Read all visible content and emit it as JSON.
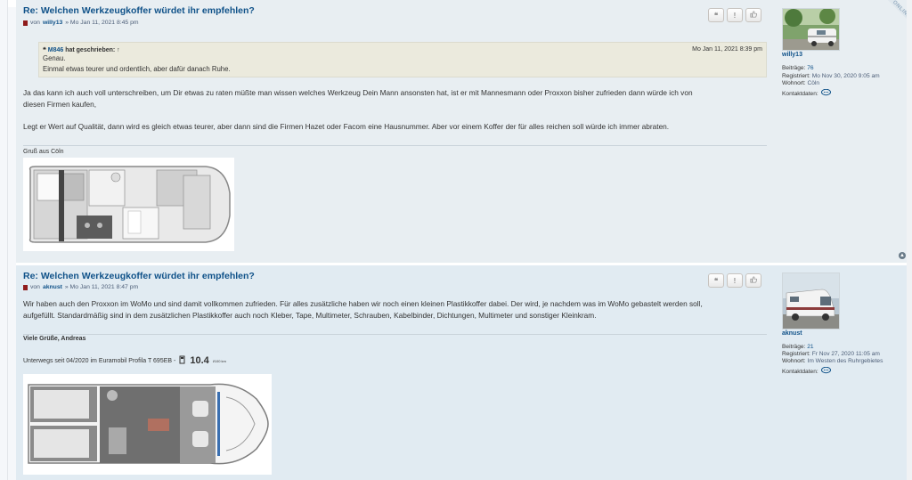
{
  "post1": {
    "title": "Re: Welchen Werkzeugkoffer würdet ihr empfehlen?",
    "by_prefix": "von",
    "author": "willy13",
    "date": "» Mo Jan 11, 2021 8:45 pm",
    "quote": {
      "name": "M846",
      "wrote": "hat geschrieben: ↑",
      "date": "Mo Jan 11, 2021 8:39 pm",
      "lines": [
        "Genau.",
        "Einmal etwas teurer und ordentlich, aber dafür danach Ruhe."
      ]
    },
    "body": [
      "Ja das kann ich auch voll unterschreiben, um Dir etwas zu raten müßte man wissen welches Werkzeug Dein Mann ansonsten hat, ist er mit Mannesmann oder Proxxon bisher zufrieden dann würde ich von",
      "diesen Firmen kaufen,",
      "Legt er Wert auf Qualität, dann wird es gleich etwas teurer, aber dann sind die Firmen Hazet oder Facom eine Hausnummer. Aber vor einem Koffer der für alles reichen soll würde ich immer abraten."
    ],
    "signature": "Gruß aus Cöln",
    "profile": {
      "username": "willy13",
      "online_badge": "ONLINE",
      "posts_label": "Beiträge:",
      "posts": "76",
      "registered_label": "Registriert:",
      "registered": "Mo Nov 30, 2020 9:05 am",
      "location_label": "Wohnort:",
      "location": "Cöln",
      "contact_label": "Kontaktdaten:"
    }
  },
  "post2": {
    "title": "Re: Welchen Werkzeugkoffer würdet ihr empfehlen?",
    "by_prefix": "von",
    "author": "aknust",
    "date": "» Mo Jan 11, 2021 8:47 pm",
    "body": [
      "Wir haben auch den Proxxon im WoMo und sind damit vollkommen zufrieden. Für alles zusätzliche haben wir noch einen kleinen Plastikkoffer dabei. Der wird, je nachdem was im WoMo gebastelt werden soll,",
      "aufgefüllt. Standardmäßig sind in dem zusätzlichen Plastikkoffer auch noch Kleber, Tape, Multimeter, Schrauben, Kabelbinder, Dichtungen, Multimeter und sonstiger Kleinkram."
    ],
    "signature_bold": "Viele Grüße, Andreas",
    "signature_line": "Unterwegs seit 04/2020 im Euramobil Profila T 695EB -",
    "fuel_value": "10.4",
    "fuel_unit": "l/100 km",
    "profile": {
      "username": "aknust",
      "posts_label": "Beiträge:",
      "posts": "21",
      "registered_label": "Registriert:",
      "registered": "Fr Nov 27, 2020 11:05 am",
      "location_label": "Wohnort:",
      "location": "Im Westen des Ruhrgebietes",
      "contact_label": "Kontaktdaten:"
    }
  },
  "buttons": {
    "quote": "❝",
    "report": "!",
    "like": "👍"
  },
  "colors": {
    "link": "#105289",
    "post_bg_1": "#e8eef2",
    "post_bg_2": "#e1ebf2",
    "quote_bg": "#ebeadd"
  }
}
